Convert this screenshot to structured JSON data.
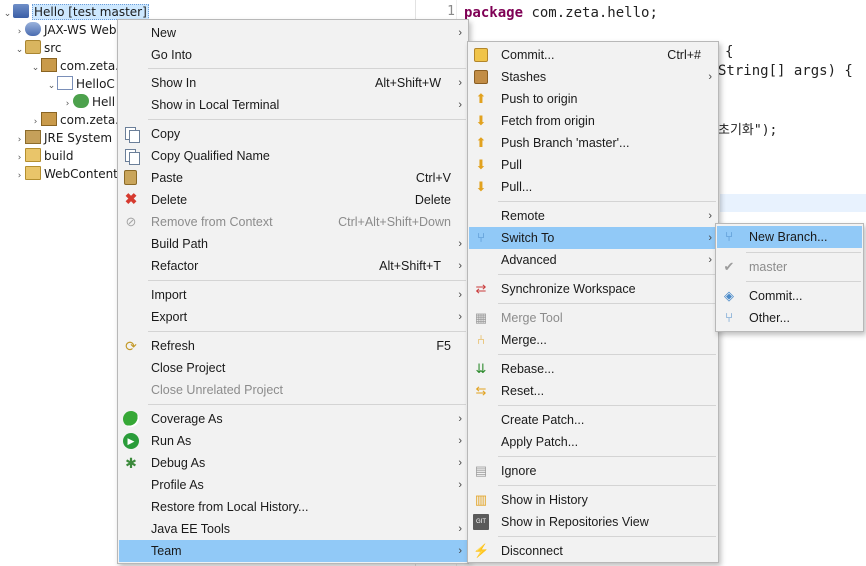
{
  "tree": {
    "project": "Hello [test master]",
    "jaxws": "JAX-WS Web",
    "src": "src",
    "pkg1": "com.zeta.",
    "java_file": "HelloC",
    "class_item": "Hell",
    "pkg2": "com.zeta.",
    "jre": "JRE System L",
    "build": "build",
    "webcontent": "WebContent"
  },
  "editor": {
    "line1_number": "1",
    "line1_keyword": "package",
    "line1_rest": " com.zeta.hello;",
    "line2": "{",
    "line3": "String[] args) {",
    "line4": "초기화\");"
  },
  "context_menu": {
    "items": [
      {
        "label": "New",
        "accel": "",
        "submenu": true
      },
      {
        "label": "Go Into",
        "accel": ""
      },
      {
        "label": "Show In",
        "accel": "Alt+Shift+W",
        "submenu": true
      },
      {
        "label": "Show in Local Terminal",
        "accel": "",
        "submenu": true
      },
      {
        "label": "Copy",
        "accel": ""
      },
      {
        "label": "Copy Qualified Name",
        "accel": ""
      },
      {
        "label": "Paste",
        "accel": "Ctrl+V"
      },
      {
        "label": "Delete",
        "accel": "Delete"
      },
      {
        "label": "Remove from Context",
        "accel": "Ctrl+Alt+Shift+Down"
      },
      {
        "label": "Build Path",
        "accel": "",
        "submenu": true
      },
      {
        "label": "Refactor",
        "accel": "Alt+Shift+T",
        "submenu": true
      },
      {
        "label": "Import",
        "accel": "",
        "submenu": true
      },
      {
        "label": "Export",
        "accel": "",
        "submenu": true
      },
      {
        "label": "Refresh",
        "accel": "F5"
      },
      {
        "label": "Close Project",
        "accel": ""
      },
      {
        "label": "Close Unrelated Project",
        "accel": ""
      },
      {
        "label": "Coverage As",
        "accel": "",
        "submenu": true
      },
      {
        "label": "Run As",
        "accel": "",
        "submenu": true
      },
      {
        "label": "Debug As",
        "accel": "",
        "submenu": true
      },
      {
        "label": "Profile As",
        "accel": "",
        "submenu": true
      },
      {
        "label": "Restore from Local History...",
        "accel": ""
      },
      {
        "label": "Java EE Tools",
        "accel": "",
        "submenu": true
      },
      {
        "label": "Team",
        "accel": "",
        "submenu": true
      }
    ]
  },
  "team_menu": {
    "items": [
      {
        "label": "Commit...",
        "accel": "Ctrl+#"
      },
      {
        "label": "Stashes",
        "accel": "",
        "submenu": true
      },
      {
        "label": "Push to origin",
        "accel": ""
      },
      {
        "label": "Fetch from origin",
        "accel": ""
      },
      {
        "label": "Push Branch 'master'...",
        "accel": ""
      },
      {
        "label": "Pull",
        "accel": ""
      },
      {
        "label": "Pull...",
        "accel": ""
      },
      {
        "label": "Remote",
        "accel": "",
        "submenu": true
      },
      {
        "label": "Switch To",
        "accel": "",
        "submenu": true
      },
      {
        "label": "Advanced",
        "accel": "",
        "submenu": true
      },
      {
        "label": "Synchronize Workspace",
        "accel": ""
      },
      {
        "label": "Merge Tool",
        "accel": ""
      },
      {
        "label": "Merge...",
        "accel": ""
      },
      {
        "label": "Rebase...",
        "accel": ""
      },
      {
        "label": "Reset...",
        "accel": ""
      },
      {
        "label": "Create Patch...",
        "accel": ""
      },
      {
        "label": "Apply Patch...",
        "accel": ""
      },
      {
        "label": "Ignore",
        "accel": ""
      },
      {
        "label": "Show in History",
        "accel": ""
      },
      {
        "label": "Show in Repositories View",
        "accel": ""
      },
      {
        "label": "Disconnect",
        "accel": ""
      }
    ]
  },
  "switch_menu": {
    "items": [
      {
        "label": "New Branch..."
      },
      {
        "label": "master"
      },
      {
        "label": "Commit..."
      },
      {
        "label": "Other..."
      }
    ]
  },
  "submenu_glyph": "›"
}
